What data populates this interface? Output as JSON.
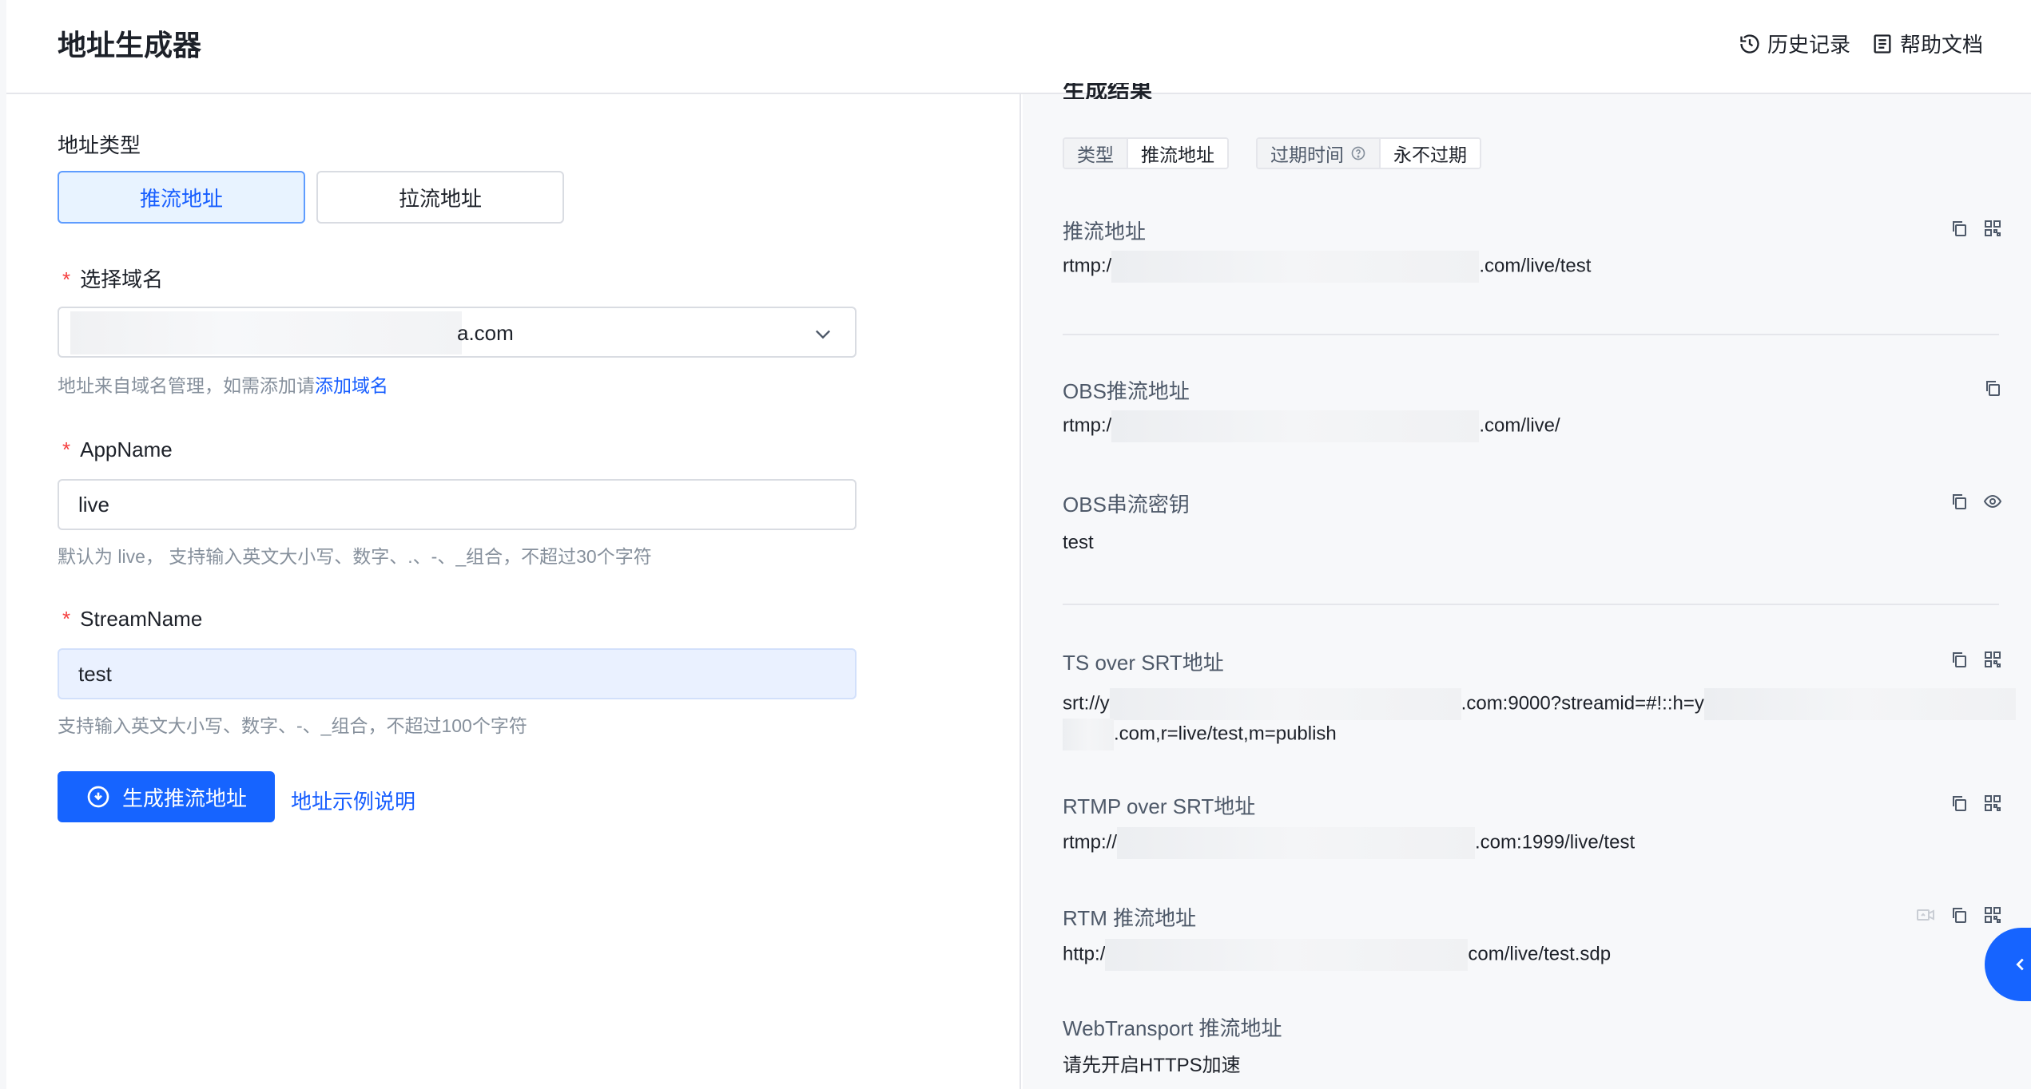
{
  "header": {
    "title": "地址生成器",
    "history_label": "历史记录",
    "help_label": "帮助文档"
  },
  "form": {
    "address_type_label": "地址类型",
    "type_options": [
      "推流地址",
      "拉流地址"
    ],
    "selected_type": "推流地址",
    "domain_label": "选择域名",
    "domain_value_suffix": "a.com",
    "domain_hint_prefix": "地址来自域名管理，如需添加请",
    "domain_hint_link": "添加域名",
    "appname_label": "AppName",
    "appname_value": "live",
    "appname_hint": "默认为 live， 支持输入英文大小写、数字、.、-、_组合，不超过30个字符",
    "streamname_label": "StreamName",
    "streamname_value": "test",
    "streamname_hint": "支持输入英文大小写、数字、-、_组合，不超过100个字符",
    "generate_button": "生成推流地址",
    "example_link": "地址示例说明"
  },
  "result": {
    "section_title": "生成结果",
    "tag_type_key": "类型",
    "tag_type_value": "推流地址",
    "tag_expire_key": "过期时间",
    "tag_expire_value": "永不过期",
    "push_label": "推流地址",
    "push_prefix": "rtmp:/",
    "push_suffix": ".com/live/test",
    "obs_push_label": "OBS推流地址",
    "obs_push_prefix": "rtmp:/",
    "obs_push_suffix": ".com/live/",
    "obs_key_label": "OBS串流密钥",
    "obs_key_value": "test",
    "ts_srt_label": "TS over SRT地址",
    "ts_srt_prefix": "srt://y",
    "ts_srt_middle": ".com:9000?streamid=#!::h=y",
    "ts_srt_line2": ".com,r=live/test,m=publish",
    "rtmp_srt_label": "RTMP over SRT地址",
    "rtmp_srt_prefix": "rtmp://",
    "rtmp_srt_suffix": ".com:1999/live/test",
    "rtm_label": "RTM 推流地址",
    "rtm_prefix": "http:/",
    "rtm_suffix": "com/live/test.sdp",
    "webtransport_label": "WebTransport 推流地址",
    "webtransport_value": "请先开启HTTPS加速"
  },
  "colors": {
    "primary": "#1664ff",
    "required": "#f53f3f",
    "hint": "#86909c"
  }
}
